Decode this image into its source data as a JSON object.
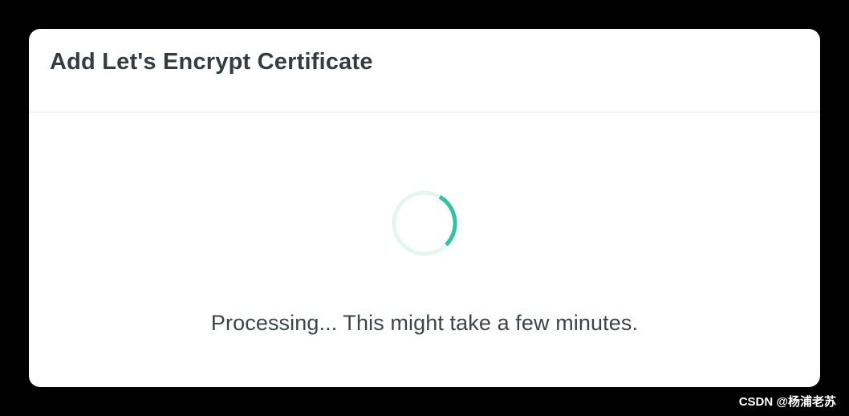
{
  "modal": {
    "title": "Add Let's Encrypt Certificate",
    "processing_text": "Processing... This might take a few minutes."
  },
  "spinner": {
    "icon": "loading-spinner-icon",
    "track_color": "#e3f6f1",
    "arc_color": "#2ec4a2"
  },
  "watermark": {
    "text": "CSDN @杨浦老苏"
  }
}
